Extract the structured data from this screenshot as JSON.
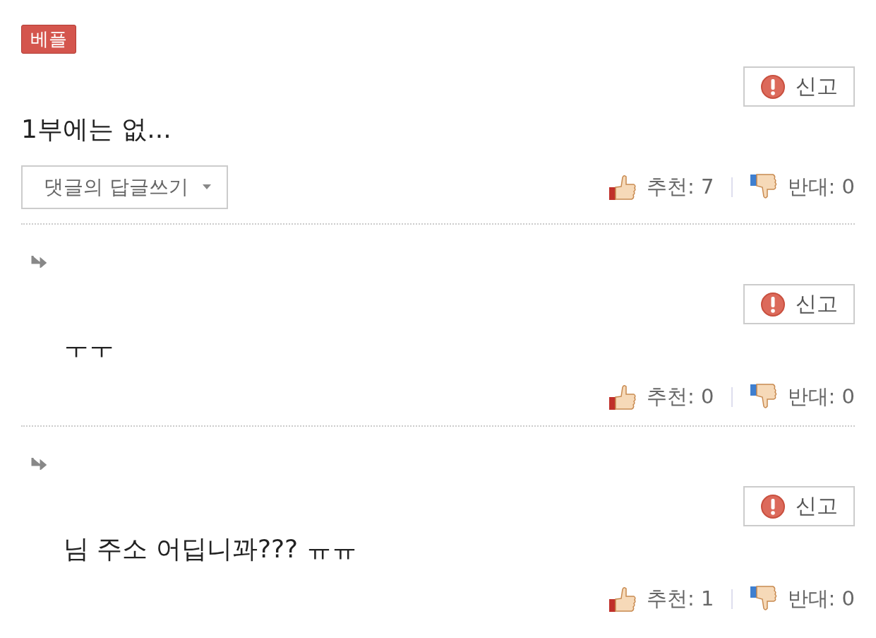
{
  "comments": [
    {
      "kind": "best",
      "badge": "베플",
      "report": "신고",
      "text": "1부에는 없...",
      "reply_button": "댓글의 답글쓰기",
      "likes": "추천: 7",
      "dislikes": "반대: 0"
    },
    {
      "kind": "reply",
      "report": "신고",
      "text": "ㅜㅜ",
      "likes": "추천: 0",
      "dislikes": "반대: 0"
    },
    {
      "kind": "reply",
      "report": "신고",
      "text": "님 주소 어딥니꽈??? ㅠㅠ",
      "likes": "추천: 1",
      "dislikes": "반대: 0"
    }
  ]
}
